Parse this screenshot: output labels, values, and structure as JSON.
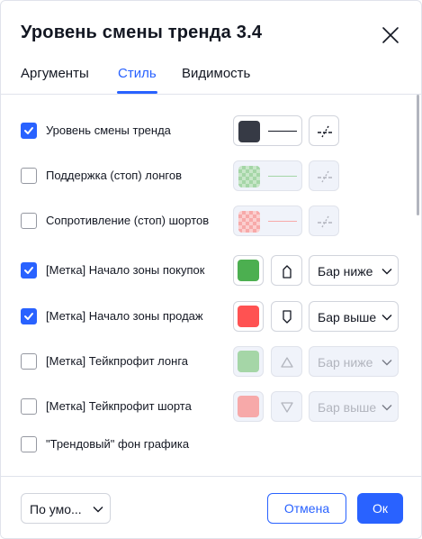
{
  "dialog": {
    "title": "Уровень смены тренда 3.4"
  },
  "tabs": [
    {
      "label": "Аргументы",
      "active": false
    },
    {
      "label": "Стиль",
      "active": true
    },
    {
      "label": "Видимость",
      "active": false
    }
  ],
  "rows": [
    {
      "label": "Уровень смены тренда",
      "checked": true,
      "color": "#363a45"
    },
    {
      "label": "Поддержка (стоп) лонгов",
      "checked": false,
      "color": "#a5d6a7"
    },
    {
      "label": "Сопротивление (стоп) шортов",
      "checked": false,
      "color": "#f7a9a9"
    },
    {
      "label": "[Метка] Начало зоны покупок",
      "checked": true,
      "color": "#4caf50",
      "position": "Бар ниже"
    },
    {
      "label": "[Метка] Начало зоны продаж",
      "checked": true,
      "color": "#ff5252",
      "position": "Бар выше"
    },
    {
      "label": "[Метка] Тейкпрофит лонга",
      "checked": false,
      "color": "#a5d6a7",
      "position": "Бар ниже"
    },
    {
      "label": "[Метка] Тейкпрофит шорта",
      "checked": false,
      "color": "#f7a9a9",
      "position": "Бар выше"
    },
    {
      "label": "\"Трендовый\" фон графика",
      "checked": false
    }
  ],
  "footer": {
    "defaults_label": "По умо...",
    "cancel_label": "Отмена",
    "ok_label": "Ок"
  },
  "colors": {
    "accent": "#2962ff",
    "border": "#d1d4dc",
    "disabled_bg": "#f0f3fa"
  },
  "icons": {
    "close": "close-icon",
    "checkmark": "checkmark-icon",
    "line_style": "line-style-icon",
    "chevron": "chevron-down-icon",
    "label_shape": "label-shape-icon",
    "triangle_up": "triangle-up-icon",
    "triangle_down": "triangle-down-icon"
  }
}
